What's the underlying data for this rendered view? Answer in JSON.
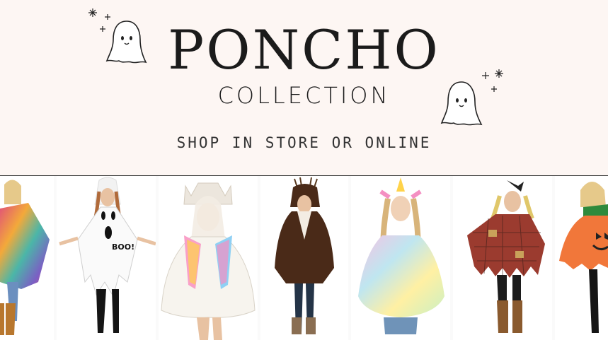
{
  "banner": {
    "title": "PONCHO",
    "subtitle": "COLLECTION",
    "tagline": "SHOP IN STORE OR ONLINE",
    "ghost_text": ""
  },
  "products": [
    {
      "name": "tie-dye-fringe-poncho",
      "color": "#d74a7b"
    },
    {
      "name": "ghost-poncho",
      "color": "#ffffff",
      "label": "BOO!"
    },
    {
      "name": "llama-poncho",
      "color": "#f6f3ef"
    },
    {
      "name": "deer-poncho",
      "color": "#4a2a18"
    },
    {
      "name": "unicorn-tie-dye-poncho",
      "color": "#bfe6f0"
    },
    {
      "name": "scarecrow-poncho",
      "color": "#9b3b2f"
    },
    {
      "name": "pumpkin-poncho",
      "color": "#f1773a"
    }
  ]
}
